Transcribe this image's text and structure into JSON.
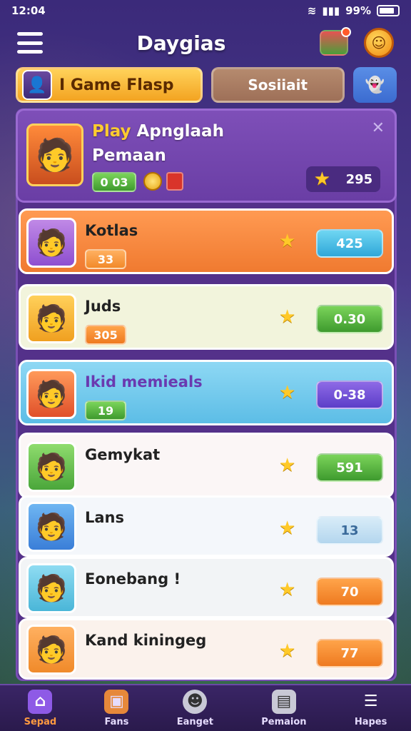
{
  "status": {
    "time": "12:04",
    "battery": "99%"
  },
  "header": {
    "title": "Daygias"
  },
  "tabs": {
    "game": "I Game Flasp",
    "second": "Sosiiait"
  },
  "hero": {
    "name_play": "Play",
    "name_rest": " Apnglaah",
    "sub": "Pemaan",
    "badge": "0 03",
    "score": "295"
  },
  "rows": [
    {
      "name": "Kotlas",
      "pill": "33",
      "value": "425"
    },
    {
      "name": "Juds",
      "pill": "305",
      "value": "0.30"
    },
    {
      "name": "Ikid memieals",
      "pill": "19",
      "value": "0-38"
    },
    {
      "name": "Gemykat",
      "pill": "",
      "value": "591"
    },
    {
      "name": "Lans",
      "pill": "",
      "value": "13"
    },
    {
      "name": "Eonebang !",
      "pill": "",
      "value": "70"
    },
    {
      "name": "Kand kiningeg",
      "pill": "",
      "value": "77"
    }
  ],
  "nav": {
    "n1": "Sepad",
    "n2": "Fans",
    "n3": "Eanget",
    "n4": "Pemaion",
    "n5": "Hapes"
  }
}
